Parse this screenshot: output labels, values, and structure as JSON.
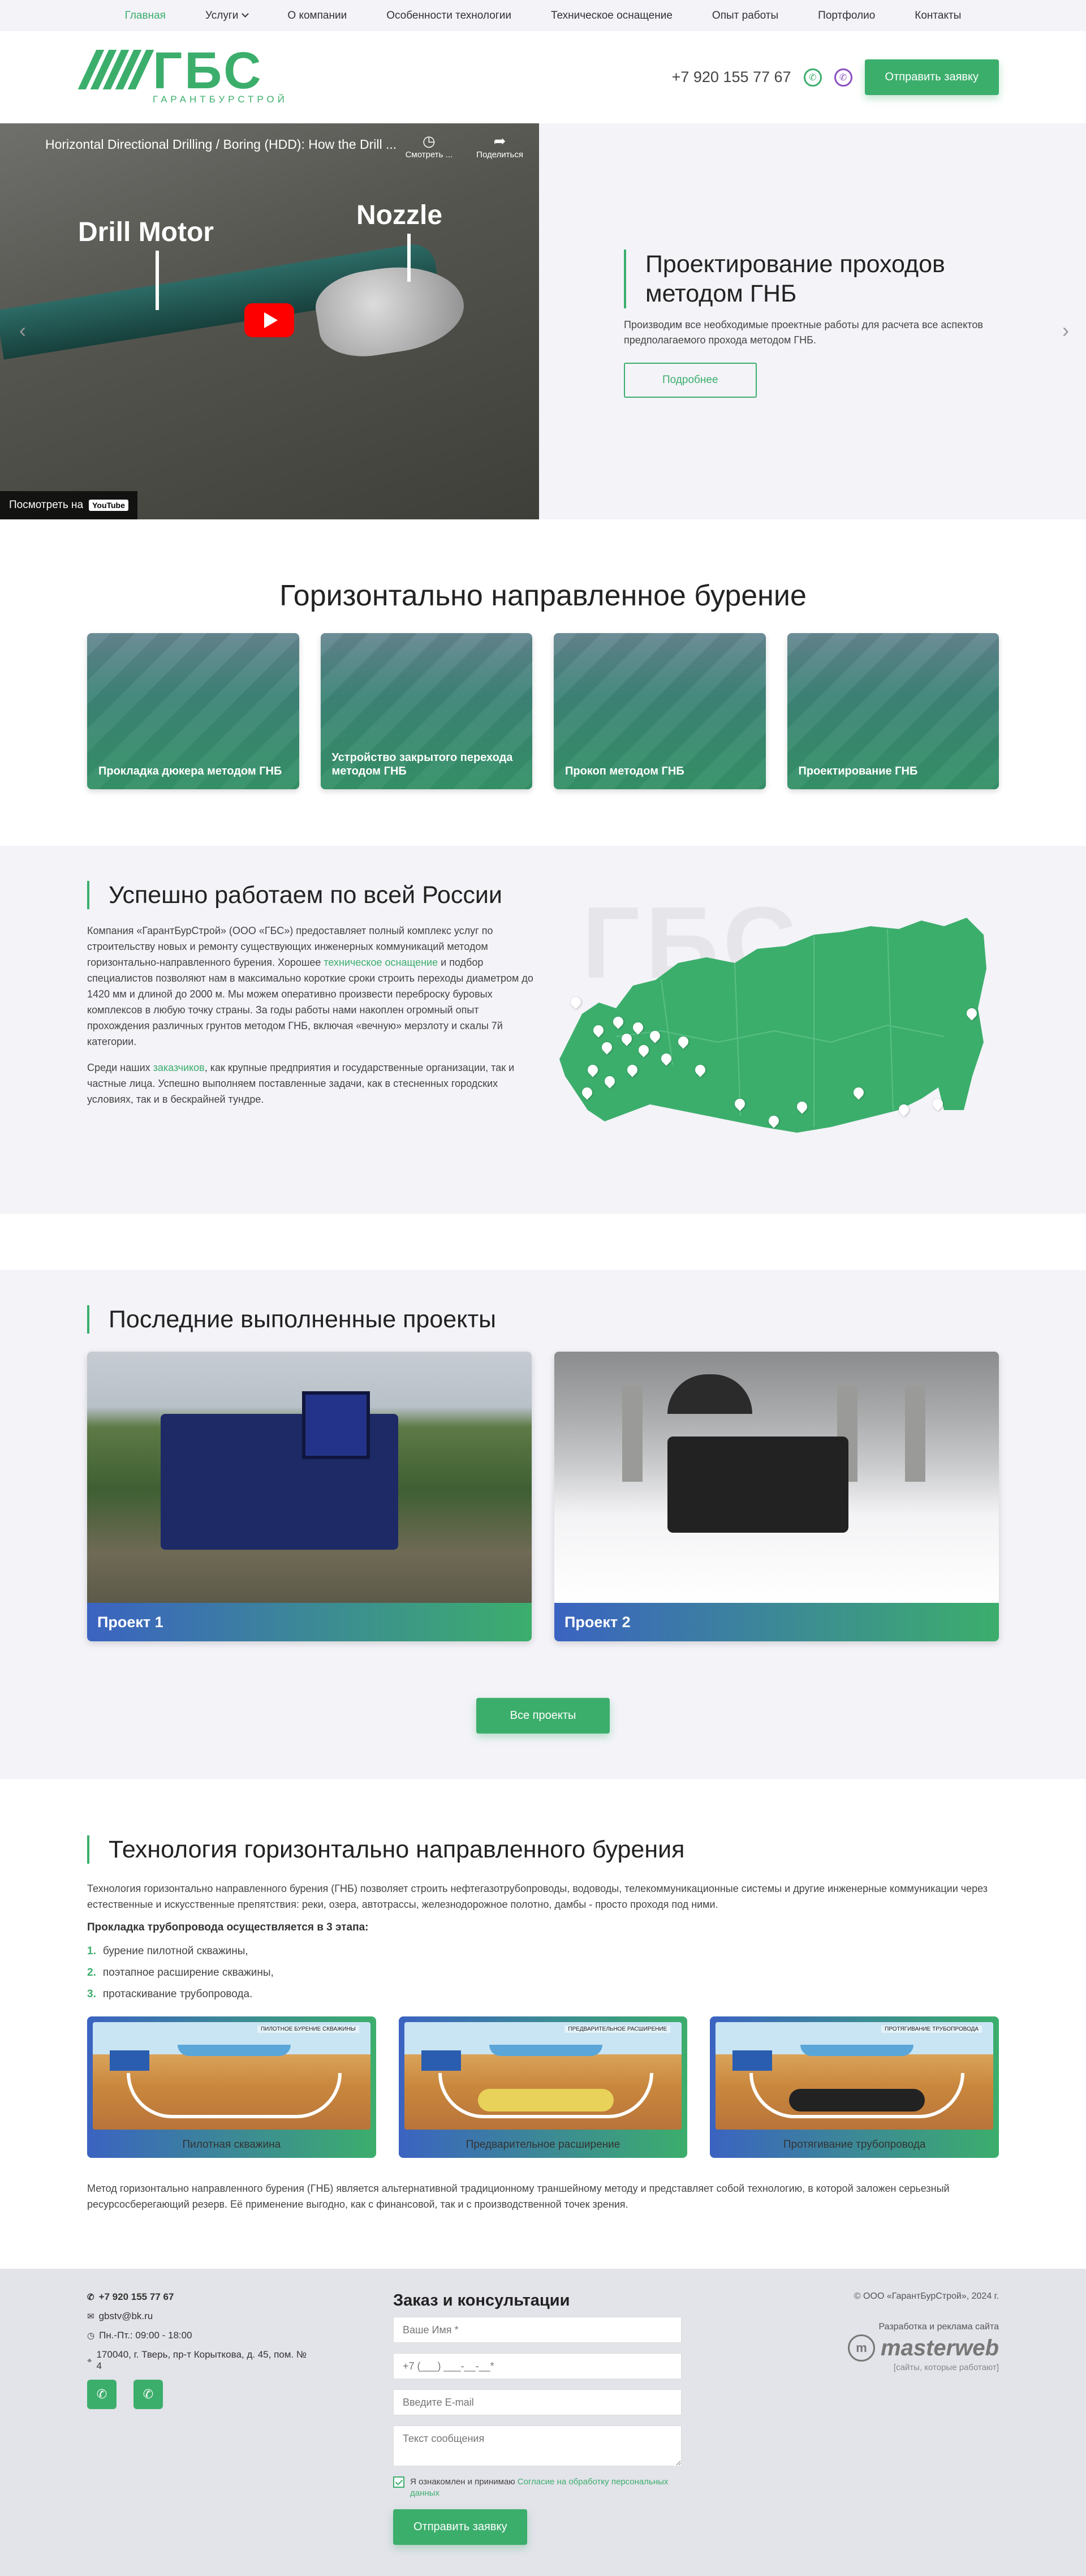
{
  "nav": {
    "items": [
      {
        "label": "Главная",
        "active": true
      },
      {
        "label": "Услуги",
        "dropdown": true
      },
      {
        "label": "О компании"
      },
      {
        "label": "Особенности технологии"
      },
      {
        "label": "Техническое оснащение"
      },
      {
        "label": "Опыт работы"
      },
      {
        "label": "Портфолио"
      },
      {
        "label": "Контакты"
      }
    ]
  },
  "header": {
    "logo_big": "ГБС",
    "logo_small": "ГАРАНТБУРСТРОЙ",
    "phone": "+7 920 155 77 67",
    "cta": "Отправить заявку"
  },
  "hero": {
    "video": {
      "title": "Horizontal Directional Drilling / Boring (HDD): How the Drill ...",
      "watch_later": "Смотреть ...",
      "share": "Поделиться",
      "label_motor": "Drill Motor",
      "label_nozzle": "Nozzle",
      "watch_on": "Посмотреть на",
      "yt": "YouTube"
    },
    "title": "Проектирование проходов методом ГНБ",
    "text": "Производим все необходимые проектные работы для расчета все аспектов предполагаемого прохода методом ГНБ.",
    "button": "Подробнее"
  },
  "services": {
    "title": "Горизонтально направленное бурение",
    "cards": [
      {
        "label": "Прокладка дюкера методом ГНБ"
      },
      {
        "label": "Устройство закрытого перехода методом ГНБ"
      },
      {
        "label": "Прокоп методом ГНБ"
      },
      {
        "label": "Проектирование ГНБ"
      }
    ]
  },
  "russia": {
    "title": "Успешно работаем по всей России",
    "p1_a": "Компания «ГарантБурСтрой» (ООО «ГБС») предоставляет полный комплекс услуг по строительству новых и ремонту существующих инженерных коммуникаций методом горизонтально-направленного бурения. Хорошее ",
    "p1_link": "техническое оснащение",
    "p1_b": " и подбор специалистов позволяют нам в максимально короткие сроки строить переходы диаметром до 1420 мм и длиной до 2000 м. Мы можем оперативно произвести переброску буровых комплексов в любую точку страны. За годы работы нами накоплен огромный опыт прохождения различных грунтов методом ГНБ, включая «вечную» мерзлоту и скалы 7й категории.",
    "p2_a": "Среди наших ",
    "p2_link": "заказчиков",
    "p2_b": ", как крупные предприятия и государственные организации, так и частные лица. Успешно выполняем поставленные задачи, как в стесненных городских условиях, так и в бескрайней тундре.",
    "map_watermark": "ГБС"
  },
  "projects": {
    "title": "Последние выполненные проекты",
    "items": [
      {
        "label": "Проект 1"
      },
      {
        "label": "Проект 2"
      }
    ],
    "all_button": "Все проекты"
  },
  "tech": {
    "title": "Технология горизонтально направленного бурения",
    "intro": "Технология горизонтально направленного бурения (ГНБ) позволяет строить нефтегазотрубопроводы, водоводы, телекоммуникационные системы и другие инженерные коммуникации через естественные и искусственные препятствия: реки, озера, автотрассы, железнодорожное полотно, дамбы - просто проходя под ними.",
    "stages_title": "Прокладка трубопровода осуществляется в 3 этапа:",
    "stages": [
      {
        "num": "1.",
        "text": "бурение пилотной скважины,"
      },
      {
        "num": "2.",
        "text": "поэтапное расширение скважины,"
      },
      {
        "num": "3.",
        "text": "протаскивание трубопровода."
      }
    ],
    "diagrams": [
      {
        "tag": "ПИЛОТНОЕ БУРЕНИЕ СКВАЖИНЫ",
        "caption": "Пилотная скважина"
      },
      {
        "tag": "ПРЕДВАРИТЕЛЬНОЕ РАСШИРЕНИЕ",
        "caption": "Предварительное расширение"
      },
      {
        "tag": "ПРОТЯГИВАНИЕ ТРУБОПРОВОДА",
        "caption": "Протягивание трубопровода"
      }
    ],
    "outro": "Метод горизонтально направленного бурения (ГНБ) является альтернативной традиционному траншейному методу и представляет собой технологию, в которой заложен серьезный ресурсосберегающий резерв. Её применение выгодно, как с финансовой, так и с производственной точек зрения."
  },
  "footer": {
    "phone": "+7 920 155 77 67",
    "email": "gbstv@bk.ru",
    "hours": "Пн.-Пт.: 09:00 - 18:00",
    "address": "170040, г. Тверь, пр-т Корыткова, д. 45, пом. № 4",
    "form_title": "Заказ и консультации",
    "name_placeholder": "Ваше Имя *",
    "phone_placeholder": "+7 (___) ___-__-__*",
    "email_placeholder": "Введите E-mail",
    "message_placeholder": "Текст сообщения",
    "consent_a": "Я ознакомлен и принимаю ",
    "consent_link": "Согласие на обработку персональных данных",
    "submit": "Отправить заявку",
    "copyright": "© ООО «ГарантБурСтрой», 2024 г.",
    "dev_label": "Разработка и реклама сайта",
    "dev_logo": "masterweb",
    "dev_tagline": "[сайты, которые работают]"
  },
  "colors": {
    "accent": "#3cae6c",
    "blue": "#3b63c1",
    "bg_light": "#f3f3f8",
    "footer_bg": "#e3e3ea"
  }
}
